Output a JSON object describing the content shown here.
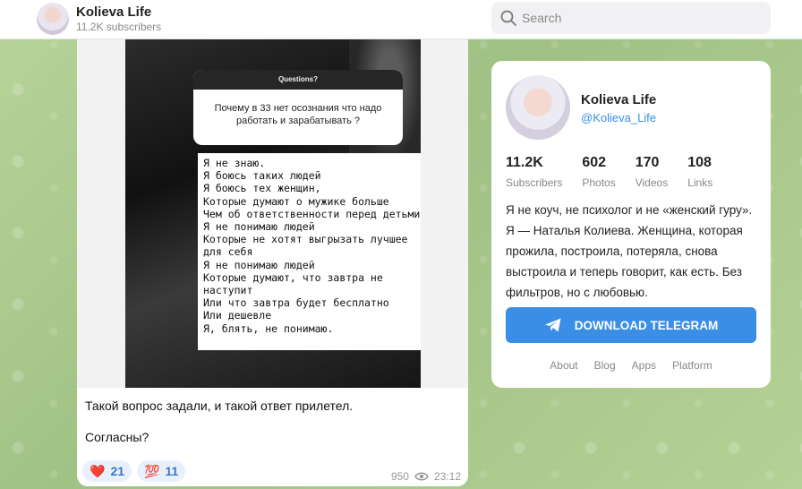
{
  "header": {
    "channel_title": "Kolieva Life",
    "channel_subscribers": "11.2K subscribers",
    "search_placeholder": "Search"
  },
  "post": {
    "image": {
      "question_header": "Questions?",
      "question_text": "Почему в 33 нет осознания что надо работать и зарабатывать ?",
      "answer_lines": [
        "Я не знаю.",
        "Я боюсь таких людей",
        "Я боюсь тех женщин,",
        "Которые думают о мужике больше",
        "Чем об ответственности перед детьми",
        "Я не понимаю людей",
        "Которые не хотят  выгрызать лучшее",
        "для себя",
        "Я не понимаю людей",
        "Которые думают, что завтра не",
        "наступит",
        "Или что завтра будет бесплатно",
        "Или дешевле",
        "Я, блять, не понимаю."
      ]
    },
    "text_p1": "Такой вопрос задали, и такой ответ прилетел.",
    "text_p2": "Согласны?",
    "reactions": [
      {
        "emoji": "❤️",
        "count": "21"
      },
      {
        "emoji": "💯",
        "count": "11"
      }
    ],
    "views": "950",
    "time": "23:12"
  },
  "profile": {
    "name": "Kolieva Life",
    "handle": "@Kolieva_Life",
    "stats": [
      {
        "num": "11.2K",
        "label": "Subscribers"
      },
      {
        "num": "602",
        "label": "Photos"
      },
      {
        "num": "170",
        "label": "Videos"
      },
      {
        "num": "108",
        "label": "Links"
      }
    ],
    "description": "Я не коуч, не психолог и не «женский гуру». Я — Наталья Колиева. Женщина, которая прожила, построила, потеряла, снова выстроила и теперь говорит, как есть. Без фильтров, но с любовью.",
    "download_label": "DOWNLOAD TELEGRAM",
    "links": [
      "About",
      "Blog",
      "Apps",
      "Platform"
    ]
  },
  "colors": {
    "accent": "#3a8ee6",
    "reaction_bg": "#e8f1fb"
  },
  "icons": {
    "search": "search-icon",
    "eye": "eye-icon",
    "telegram": "telegram-plane-icon"
  }
}
